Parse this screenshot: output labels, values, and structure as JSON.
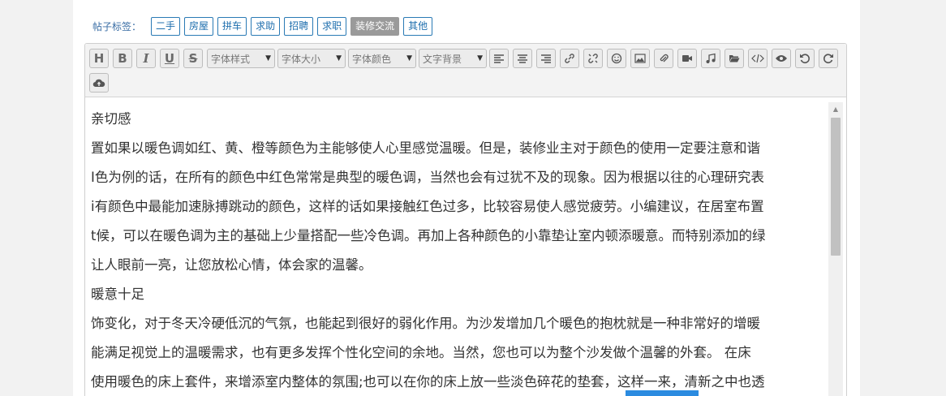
{
  "tags": {
    "label": "帖子标签：",
    "items": [
      "二手",
      "房屋",
      "拼车",
      "求助",
      "招聘",
      "求职",
      "装修交流",
      "其他"
    ],
    "active": "装修交流"
  },
  "toolbar": {
    "heading_label": "H",
    "bold_label": "B",
    "italic_label": "I",
    "underline_label": "U",
    "strike_label": "S",
    "font_style": "字体样式",
    "font_size": "字体大小",
    "font_color": "字体颜色",
    "text_bg": "文字背景"
  },
  "content": {
    "lines": [
      "亲切感",
      "置如果以暖色调如红、黄、橙等颜色为主能够使人心里感觉温暖。但是，装修业主对于颜色的使用一定要注意和谐",
      "I色为例的话，在所有的颜色中红色常常是典型的暖色调，当然也会有过犹不及的现象。因为根据以往的心理研究表",
      "i有颜色中最能加速脉搏跳动的颜色，这样的话如果接触红色过多，比较容易使人感觉疲劳。小编建议，在居室布置",
      "t候，可以在暖色调为主的基础上少量搭配一些冷色调。再加上各种颜色的小靠垫让室内顿添暖意。而特别添加的绿",
      "让人眼前一亮，让您放松心情，体会家的温馨。",
      "暖意十足",
      "饰变化，对于冬天冷硬低沉的气氛，也能起到很好的弱化作用。为沙发增加几个暖色的抱枕就是一种非常好的增暖",
      "能满足视觉上的温暖需求，也有更多发挥个性化空间的余地。当然，您也可以为整个沙发做个温馨的外套。    在床",
      "使用暖色的床上套件，来增添室内整体的氛围;也可以在你的床上放一些淡色碎花的垫套，这样一来，清新之中也透"
    ]
  },
  "colors": {
    "tag_border": "#2a7ab5",
    "tag_active_bg": "#9a9a9a",
    "accent_blue": "#2b8be0"
  }
}
